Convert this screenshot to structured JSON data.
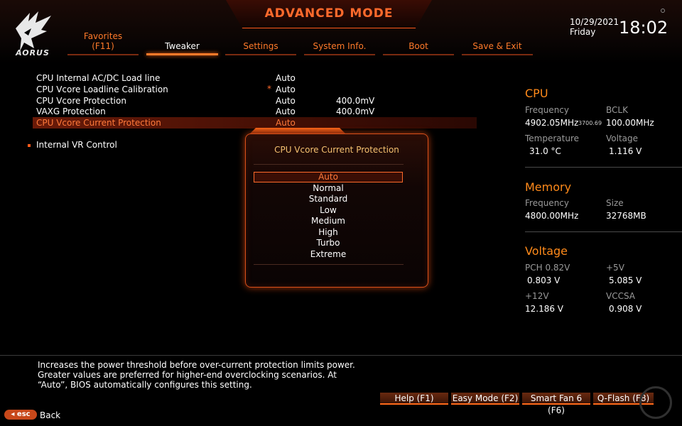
{
  "header": {
    "mode_title": "ADVANCED MODE",
    "logo_text": "AORUS",
    "date": "10/29/2021",
    "day": "Friday",
    "time": "18:02"
  },
  "tabs": [
    {
      "label": "Favorites",
      "sublabel": "(F11)"
    },
    {
      "label": "Tweaker"
    },
    {
      "label": "Settings"
    },
    {
      "label": "System Info."
    },
    {
      "label": "Boot"
    },
    {
      "label": "Save & Exit"
    }
  ],
  "settings": [
    {
      "name": "CPU Internal AC/DC Load line",
      "value": "Auto",
      "value2": ""
    },
    {
      "name": "CPU Vcore Loadline Calibration",
      "value": "Auto",
      "value2": "",
      "starred": "*"
    },
    {
      "name": "CPU Vcore Protection",
      "value": "Auto",
      "value2": "400.0mV"
    },
    {
      "name": "VAXG Protection",
      "value": "Auto",
      "value2": "400.0mV"
    },
    {
      "name": "CPU Vcore Current Protection",
      "value": "Auto",
      "value2": ""
    }
  ],
  "submenu": {
    "label": "Internal VR Control"
  },
  "popup": {
    "title": "CPU Vcore Current Protection",
    "options": [
      "Auto",
      "Normal",
      "Standard",
      "Low",
      "Medium",
      "High",
      "Turbo",
      "Extreme"
    ],
    "selected": "Auto"
  },
  "cpu": {
    "title": "CPU",
    "freq_label": "Frequency",
    "freq_value": "4902.05MHz",
    "freq_sub": "3700.69",
    "bclk_label": "BCLK",
    "bclk_value": "100.00MHz",
    "temp_label": "Temperature",
    "temp_value": "31.0 °C",
    "volt_label": "Voltage",
    "volt_value": "1.116 V"
  },
  "memory": {
    "title": "Memory",
    "freq_label": "Frequency",
    "freq_value": "4800.00MHz",
    "size_label": "Size",
    "size_value": "32768MB"
  },
  "voltage": {
    "title": "Voltage",
    "pch_label": "PCH 0.82V",
    "pch_value": "0.803 V",
    "v5_label": "+5V",
    "v5_value": "5.085 V",
    "v12_label": "+12V",
    "v12_value": "12.186 V",
    "vccsa_label": "VCCSA",
    "vccsa_value": "0.908 V"
  },
  "description": [
    "Increases the power threshold before over-current protection limits power.",
    "Greater values are preferred for higher-end overclocking scenarios. At",
    "“Auto”, BIOS automatically configures this setting."
  ],
  "footer": {
    "help": "Help (F1)",
    "easy": "Easy Mode (F2)",
    "fan": "Smart Fan 6 (F6)",
    "qflash": "Q-Flash (F8)",
    "esc": "esc",
    "back": "Back"
  },
  "colors": {
    "accent": "#ff6a2c",
    "highlight": "#ff7a3a",
    "popup_title": "#f4c070",
    "section_title": "#ff8a1a"
  }
}
